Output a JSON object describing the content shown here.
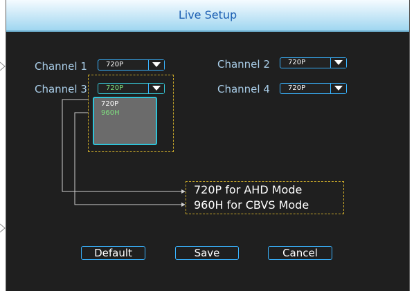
{
  "window": {
    "title": "Live Setup"
  },
  "channels": [
    {
      "label": "Channel 1",
      "value": "720P"
    },
    {
      "label": "Channel 2",
      "value": "720P"
    },
    {
      "label": "Channel 3",
      "value": "720P"
    },
    {
      "label": "Channel 4",
      "value": "720P"
    }
  ],
  "dropdown": {
    "options": [
      "720P",
      "960H"
    ],
    "highlighted": "960H"
  },
  "annotation": {
    "lines": [
      "720P for AHD Mode",
      "960H for CBVS Mode"
    ]
  },
  "buttons": {
    "default": "Default",
    "save": "Save",
    "cancel": "Cancel"
  },
  "colors": {
    "accent": "#39b3ff",
    "title": "#1c5fb3",
    "label": "#a9cde8",
    "highlight": "#7fe07f",
    "annotation_border": "#c8a82a",
    "background": "#1f1f1f"
  },
  "icons": [
    "chevron-down-icon",
    "connector-arrow-icon"
  ]
}
